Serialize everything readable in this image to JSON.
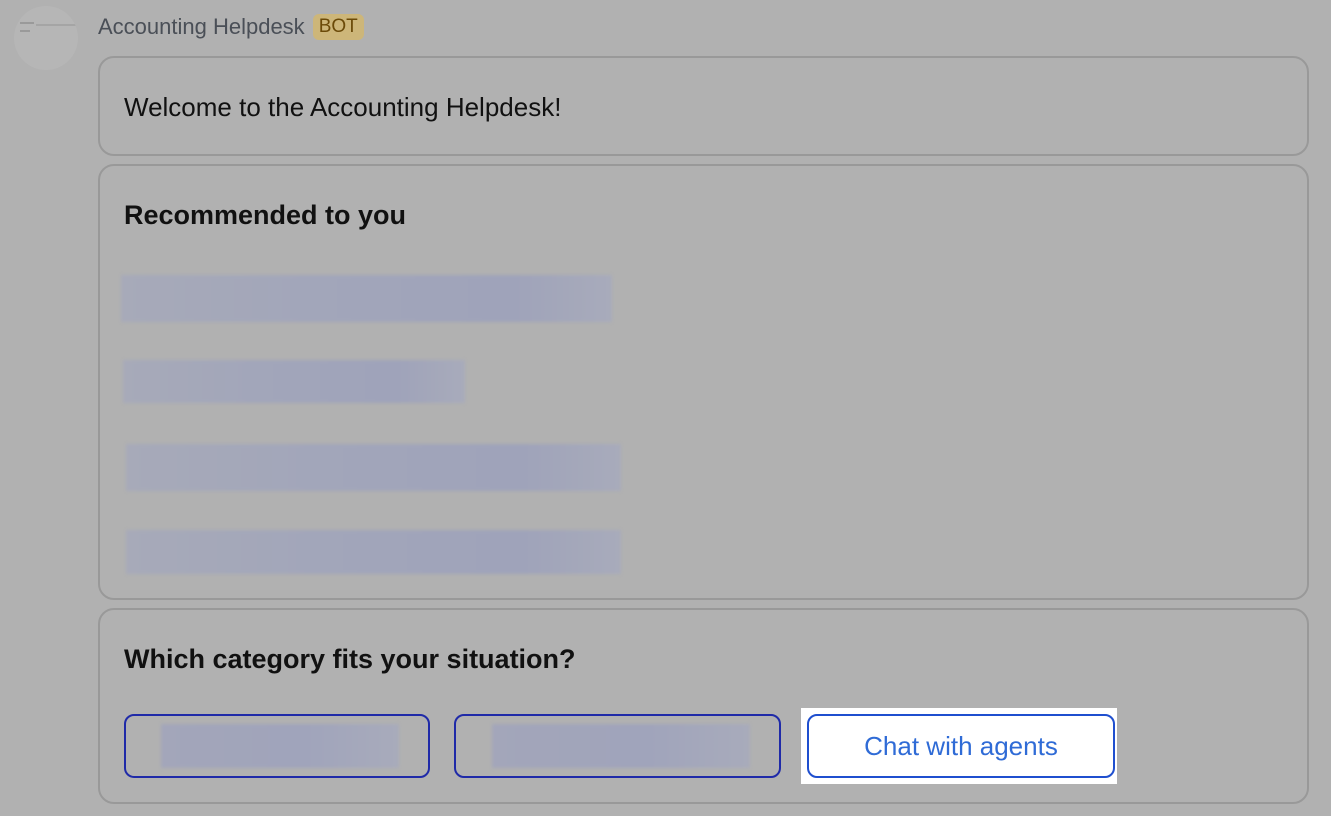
{
  "header": {
    "bot_name": "Accounting Helpdesk",
    "badge": "BOT"
  },
  "welcome": {
    "text": "Welcome to the Accounting Helpdesk!"
  },
  "recommended": {
    "title": "Recommended to you",
    "items_note": "4 recommendation links (text redacted/blurred)"
  },
  "category": {
    "title": "Which category fits your situation?",
    "options": [
      {
        "label": ""
      },
      {
        "label": ""
      },
      {
        "label": "Chat with agents"
      }
    ]
  },
  "colors": {
    "background": "#b1b1b1",
    "accent": "#2f6bd6",
    "button_border": "#1f2aa8",
    "badge_bg": "#cdb679"
  }
}
